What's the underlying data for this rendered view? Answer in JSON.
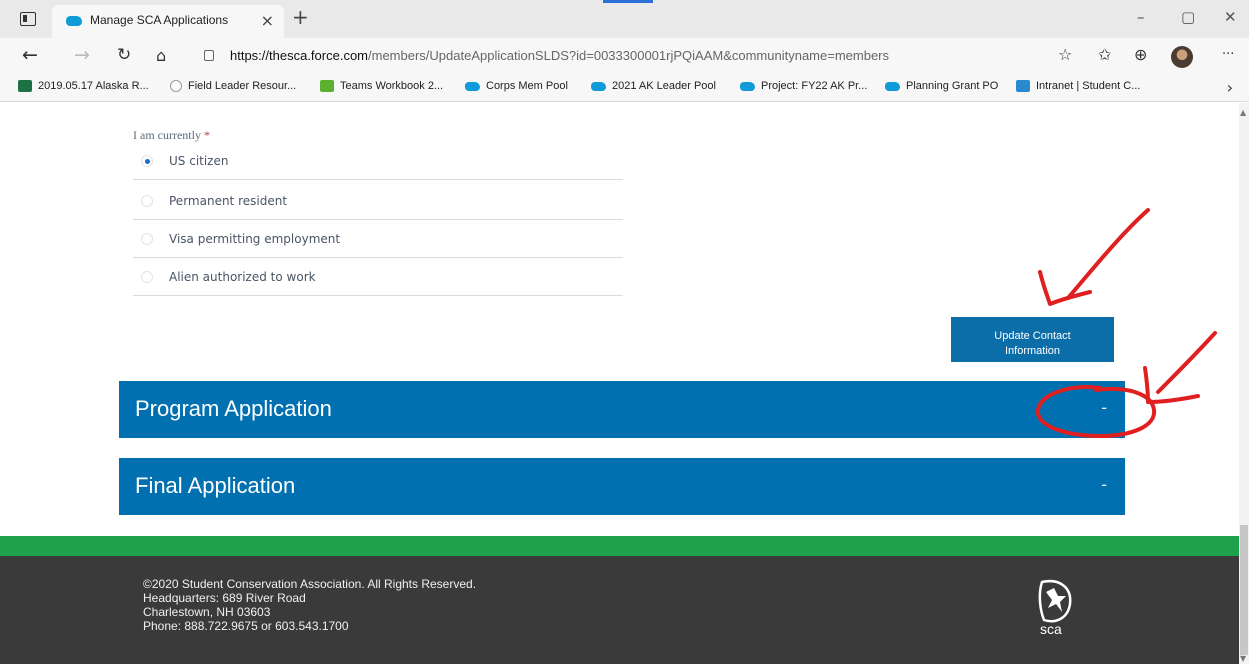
{
  "browser": {
    "tab_title": "Manage SCA Applications",
    "tab_close": "×",
    "new_tab": "+",
    "url_host": "https://thesca.force.com",
    "url_path": "/members/UpdateApplicationSLDS?id=0033300001rjPQiAAM&communityname=members",
    "window_controls": [
      "–",
      "▢",
      "✕"
    ],
    "toolbar_more": "···"
  },
  "bookmarks": [
    {
      "label": "2019.05.17 Alaska R...",
      "icon": "excel-icon"
    },
    {
      "label": "Field Leader Resour...",
      "icon": "sharepoint-icon"
    },
    {
      "label": "Teams Workbook 2...",
      "icon": "teams-icon"
    },
    {
      "label": "Corps Mem Pool",
      "icon": "salesforce-cloud-icon"
    },
    {
      "label": "2021 AK Leader Pool",
      "icon": "salesforce-cloud-icon"
    },
    {
      "label": "Project: FY22 AK Pr...",
      "icon": "salesforce-cloud-icon"
    },
    {
      "label": "Planning Grant PO",
      "icon": "salesforce-cloud-icon"
    },
    {
      "label": "Intranet | Student C...",
      "icon": "sharepoint-icon"
    }
  ],
  "form": {
    "question_label": "I am currently",
    "required_mark": "*",
    "options": [
      {
        "label": "US citizen",
        "selected": true
      },
      {
        "label": "Permanent resident",
        "selected": false
      },
      {
        "label": "Visa permitting employment",
        "selected": false
      },
      {
        "label": "Alien authorized to work",
        "selected": false
      }
    ],
    "update_button_line1": "Update Contact",
    "update_button_line2": "Information"
  },
  "sections": [
    {
      "title": "Program Application",
      "toggle": "-"
    },
    {
      "title": "Final Application",
      "toggle": "-"
    }
  ],
  "footer": {
    "line1": "©2020 Student Conservation Association. All Rights Reserved.",
    "line2": "Headquarters: 689 River Road",
    "line3": "Charlestown, NH 03603",
    "line4": "Phone: 888.722.9675 or 603.543.1700",
    "logo_text": "sca"
  },
  "colors": {
    "section_blue": "#0070b0",
    "button_blue": "#0c6ea8",
    "footer_green": "#1fa04b",
    "footer_dark": "#3a3a3a",
    "annotation_red": "#e02020"
  }
}
